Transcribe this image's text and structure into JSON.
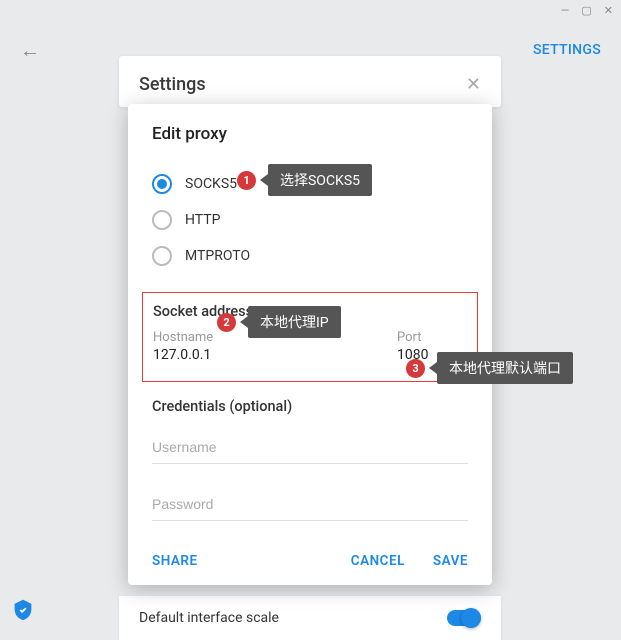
{
  "topbar": {
    "settings_link": "SETTINGS"
  },
  "settings_panel": {
    "title": "Settings"
  },
  "dialog": {
    "title": "Edit proxy",
    "radio": {
      "socks5": "SOCKS5",
      "http": "HTTP",
      "mtproto": "MTPROTO"
    },
    "socket": {
      "title": "Socket address",
      "hostname_label": "Hostname",
      "hostname_value": "127.0.0.1",
      "port_label": "Port",
      "port_value": "1080"
    },
    "credentials": {
      "title": "Credentials (optional)",
      "username_placeholder": "Username",
      "password_placeholder": "Password"
    },
    "buttons": {
      "share": "SHARE",
      "cancel": "CANCEL",
      "save": "SAVE"
    }
  },
  "bg_row": {
    "label": "Default interface scale"
  },
  "callouts": {
    "c1": {
      "num": "1",
      "text": "选择SOCKS5"
    },
    "c2": {
      "num": "2",
      "text": "本地代理IP"
    },
    "c3": {
      "num": "3",
      "text": "本地代理默认端口"
    }
  }
}
